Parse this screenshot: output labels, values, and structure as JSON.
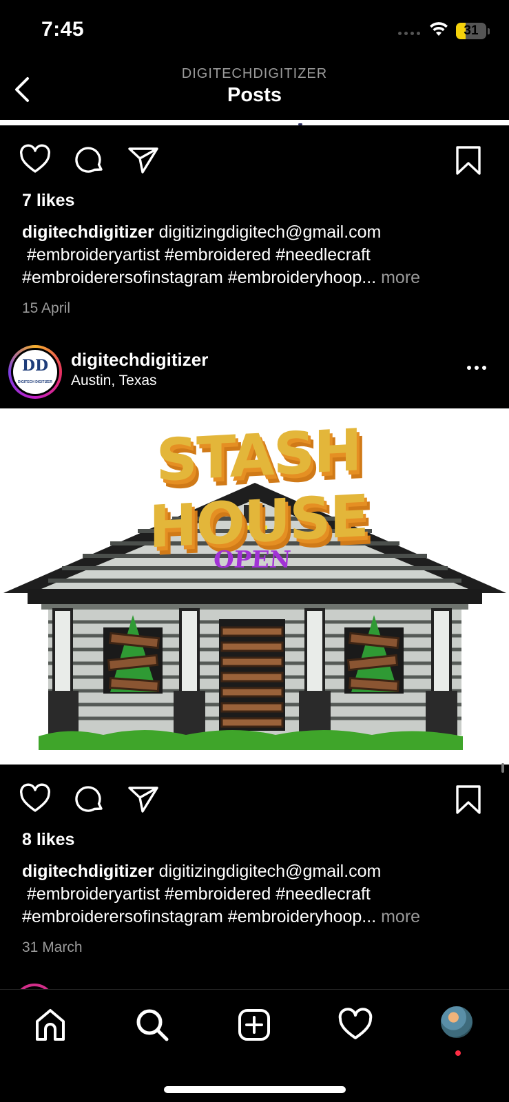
{
  "status_bar": {
    "time": "7:45",
    "battery_level": "31",
    "battery_fraction": 0.31
  },
  "header": {
    "kicker": "DIGITECHDIGITIZER",
    "title": "Posts"
  },
  "post_prev": {
    "likes": "7 likes",
    "username": "digitechdigitizer",
    "caption_line1": "digitizingdigitech@gmail.com",
    "caption_line2": "#embroideryartist #embroidered #needlecraft",
    "caption_line3": "#embroiderersofinstagram #embroideryhoop...",
    "more": "more",
    "date": "15 April"
  },
  "post": {
    "username": "digitechdigitizer",
    "location": "Austin, Texas",
    "avatar_text": "DD",
    "avatar_subtext": "DIGITECH DIGITIZER",
    "image": {
      "headline": "STASH HOUSE",
      "sign": "OPEN",
      "colors": {
        "gold": "#e3b63a",
        "orange": "#e58f23",
        "purple": "#a233d6",
        "grass": "#3fa52a"
      }
    },
    "likes": "8 likes",
    "caption_line1": "digitizingdigitech@gmail.com",
    "caption_line2": "#embroideryartist #embroidered #needlecraft",
    "caption_line3": "#embroiderersofinstagram #embroideryhoop...",
    "more": "more",
    "date": "31 March"
  },
  "tabbar": {
    "icons": [
      "home-icon",
      "search-icon",
      "create-icon",
      "heart-icon",
      "profile-avatar"
    ],
    "notification_color": "#ff2d44"
  }
}
